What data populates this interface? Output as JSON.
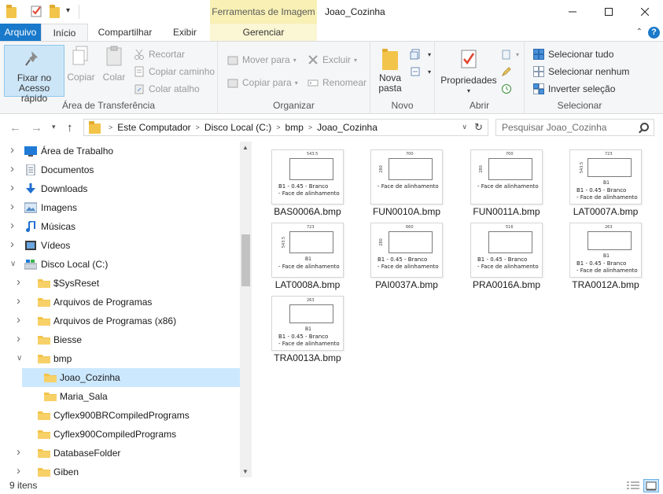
{
  "window": {
    "title": "Joao_Cozinha",
    "contextual_tab_title": "Ferramentas de Imagem",
    "minimize_icon": "minimize-icon",
    "maximize_icon": "maximize-icon",
    "close_icon": "close-icon"
  },
  "ribbon_tabs": {
    "arquivo": "Arquivo",
    "inicio": "Início",
    "compartilhar": "Compartilhar",
    "exibir": "Exibir",
    "gerenciar": "Gerenciar",
    "help": "?"
  },
  "ribbon": {
    "clipboard": {
      "group": "Área de Transferência",
      "pin_line1": "Fixar no",
      "pin_line2": "Acesso rápido",
      "copy": "Copiar",
      "paste": "Colar",
      "cut": "Recortar",
      "copy_path": "Copiar caminho",
      "paste_shortcut": "Colar atalho"
    },
    "organize": {
      "group": "Organizar",
      "move_to": "Mover para",
      "copy_to": "Copiar para",
      "delete": "Excluir",
      "rename": "Renomear"
    },
    "new": {
      "group": "Novo",
      "new_folder_line1": "Nova",
      "new_folder_line2": "pasta"
    },
    "open": {
      "group": "Abrir",
      "properties": "Propriedades"
    },
    "select": {
      "group": "Selecionar",
      "select_all": "Selecionar tudo",
      "select_none": "Selecionar nenhum",
      "invert": "Inverter seleção"
    }
  },
  "address": {
    "crumbs": [
      "Este Computador",
      "Disco Local (C:)",
      "bmp",
      "Joao_Cozinha"
    ],
    "search_placeholder": "Pesquisar Joao_Cozinha"
  },
  "nav_tree": [
    {
      "label": "Área de Trabalho",
      "icon": "desktop-icon",
      "level": 0,
      "expander": "right"
    },
    {
      "label": "Documentos",
      "icon": "documents-icon",
      "level": 0,
      "expander": "right"
    },
    {
      "label": "Downloads",
      "icon": "downloads-icon",
      "level": 0,
      "expander": "right"
    },
    {
      "label": "Imagens",
      "icon": "pictures-icon",
      "level": 0,
      "expander": "right"
    },
    {
      "label": "Músicas",
      "icon": "music-icon",
      "level": 0,
      "expander": "right"
    },
    {
      "label": "Vídeos",
      "icon": "videos-icon",
      "level": 0,
      "expander": "right"
    },
    {
      "label": "Disco Local (C:)",
      "icon": "drive-icon",
      "level": 0,
      "expander": "down"
    },
    {
      "label": "$SysReset",
      "icon": "folder-icon",
      "level": 1,
      "expander": "right"
    },
    {
      "label": "Arquivos de Programas",
      "icon": "folder-icon",
      "level": 1,
      "expander": "right"
    },
    {
      "label": "Arquivos de Programas (x86)",
      "icon": "folder-icon",
      "level": 1,
      "expander": "right"
    },
    {
      "label": "Biesse",
      "icon": "folder-icon",
      "level": 1,
      "expander": "right"
    },
    {
      "label": "bmp",
      "icon": "folder-icon",
      "level": 1,
      "expander": "down"
    },
    {
      "label": "Joao_Cozinha",
      "icon": "folder-icon",
      "level": 2,
      "expander": "none",
      "selected": true
    },
    {
      "label": "Maria_Sala",
      "icon": "folder-icon",
      "level": 2,
      "expander": "none"
    },
    {
      "label": "Cyflex900BRCompiledPrograms",
      "icon": "folder-icon",
      "level": 1,
      "expander": "none"
    },
    {
      "label": "Cyflex900CompiledPrograms",
      "icon": "folder-icon",
      "level": 1,
      "expander": "none"
    },
    {
      "label": "DatabaseFolder",
      "icon": "folder-icon",
      "level": 1,
      "expander": "right"
    },
    {
      "label": "Giben",
      "icon": "folder-icon",
      "level": 1,
      "expander": "right"
    }
  ],
  "files": [
    {
      "name": "BAS0006A.bmp",
      "width_label": "543.5",
      "height_label": "",
      "lines": [
        "B1 - 0.45 - Branco",
        "- Face de alinhamento"
      ]
    },
    {
      "name": "FUN0010A.bmp",
      "width_label": "700",
      "height_label": "280",
      "lines": [
        "- Face de alinhamento"
      ]
    },
    {
      "name": "FUN0011A.bmp",
      "width_label": "700",
      "height_label": "280",
      "lines": [
        "- Face de alinhamento"
      ]
    },
    {
      "name": "LAT0007A.bmp",
      "width_label": "723",
      "height_label": "543.5",
      "lines": [
        "B1",
        "B1 - 0.45 - Branco",
        "- Face de alinhamento"
      ]
    },
    {
      "name": "LAT0008A.bmp",
      "width_label": "723",
      "height_label": "543.5",
      "lines": [
        "B1",
        "- Face de alinhamento"
      ]
    },
    {
      "name": "PAI0037A.bmp",
      "width_label": "660",
      "height_label": "280",
      "lines": [
        "B1 - 0.45 - Branco",
        "- Face de alinhamento"
      ]
    },
    {
      "name": "PRA0016A.bmp",
      "width_label": "516",
      "height_label": "",
      "lines": [
        "B1 - 0.45 - Branco",
        "- Face de alinhamento"
      ]
    },
    {
      "name": "TRA0012A.bmp",
      "width_label": "263",
      "height_label": "",
      "lines": [
        "B1",
        "B1 - 0.45 - Branco",
        "- Face de alinhamento"
      ]
    },
    {
      "name": "TRA0013A.bmp",
      "width_label": "263",
      "height_label": "",
      "lines": [
        "B1",
        "B1 - 0.45 - Branco",
        "- Face de alinhamento"
      ]
    }
  ],
  "status": {
    "item_count": "9 itens"
  },
  "colors": {
    "accent": "#1979ca",
    "selection": "#cce8ff",
    "folder": "#f3c44a",
    "contextual_tab": "#f8f0b4"
  }
}
